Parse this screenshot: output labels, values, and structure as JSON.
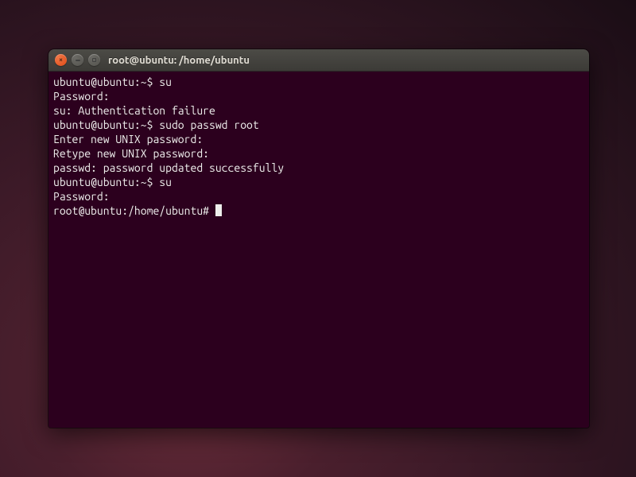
{
  "window": {
    "title": "root@ubuntu: /home/ubuntu"
  },
  "terminal": {
    "lines": [
      "ubuntu@ubuntu:~$ su",
      "Password:",
      "su: Authentication failure",
      "ubuntu@ubuntu:~$ sudo passwd root",
      "Enter new UNIX password:",
      "Retype new UNIX password:",
      "passwd: password updated successfully",
      "ubuntu@ubuntu:~$ su",
      "Password:",
      "root@ubuntu:/home/ubuntu# "
    ]
  }
}
